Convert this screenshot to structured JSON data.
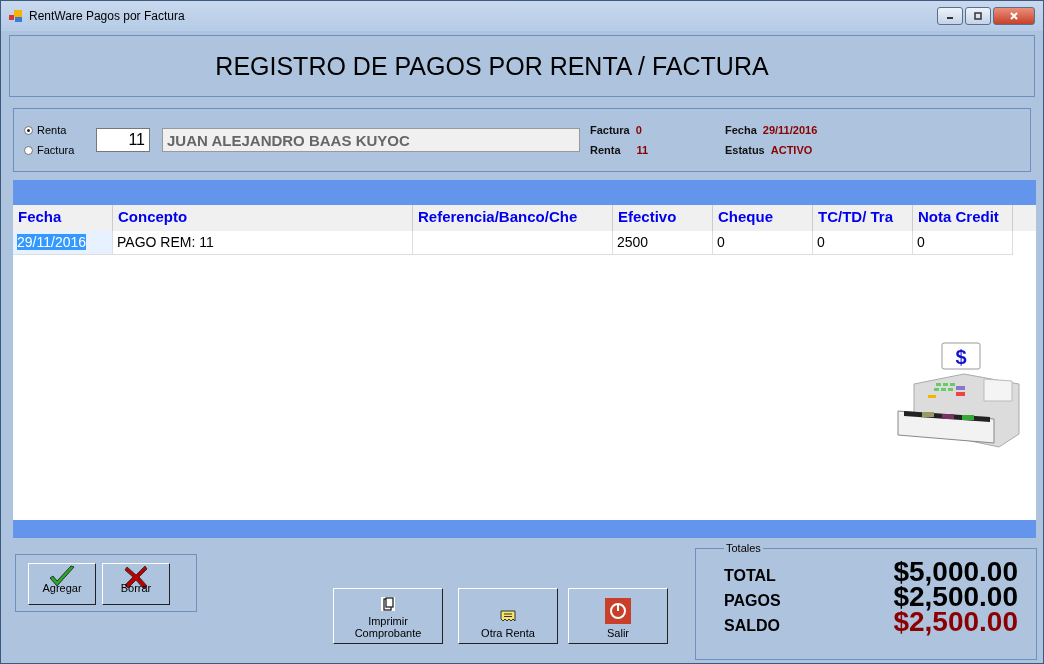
{
  "window": {
    "title": "RentWare Pagos por Factura"
  },
  "header": {
    "title": "REGISTRO DE PAGOS POR  RENTA / FACTURA"
  },
  "search": {
    "options": [
      {
        "label": "Renta",
        "selected": true
      },
      {
        "label": "Factura",
        "selected": false
      }
    ],
    "number": "11",
    "client_name": "JUAN ALEJANDRO BAAS KUYOC"
  },
  "info": [
    {
      "label": "Factura",
      "value": "0"
    },
    {
      "label": "Renta",
      "value": "11"
    },
    {
      "label": "Fecha",
      "value": "29/11/2016"
    },
    {
      "label": "Estatus",
      "value": "ACTIVO"
    }
  ],
  "table": {
    "columns": [
      "Fecha",
      "Concepto",
      "Referencia/Banco/Che",
      "Efectivo",
      "Cheque",
      "TC/TD/ Tra",
      "Nota Credit"
    ],
    "rows": [
      {
        "cells": [
          {
            "text": "29/11/2016",
            "selected": true
          },
          {
            "text": "PAGO REM: 11",
            "selected": false
          },
          {
            "text": "",
            "selected": false
          },
          {
            "text": "2500",
            "selected": false
          },
          {
            "text": "0",
            "selected": false
          },
          {
            "text": "0",
            "selected": false
          },
          {
            "text": "0",
            "selected": false
          }
        ]
      }
    ]
  },
  "edit_buttons": [
    {
      "label": "Agregar",
      "kind": "check"
    },
    {
      "label": "Borrar",
      "kind": "cross"
    }
  ],
  "action_buttons": [
    {
      "label": "Imprimir Comprobante",
      "kind": "print"
    },
    {
      "label": "Otra Renta",
      "kind": "receipt"
    },
    {
      "label": "Salir",
      "kind": "power"
    }
  ],
  "register_sign": "$",
  "totals": {
    "title": "Totales",
    "items": [
      {
        "label": "TOTAL",
        "value": "$5,000.00",
        "color": "#000000"
      },
      {
        "label": "PAGOS",
        "value": "$2,500.00",
        "color": "#000000"
      },
      {
        "label": "SALDO",
        "value": "$2,500.00",
        "color": "#8b0000"
      }
    ]
  }
}
